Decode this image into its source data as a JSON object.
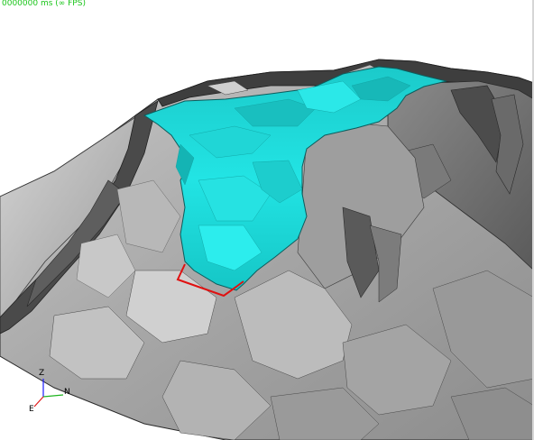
{
  "status": {
    "frame_time": "0000000 ms (∞ FPS)"
  },
  "axes": {
    "z_label": "Z",
    "n_label": "N",
    "e_label": "E",
    "z_color": "#1a1aff",
    "n_color": "#1fb51f",
    "e_color": "#e01a1a"
  },
  "colors": {
    "terrain_light": "#d2d2d2",
    "terrain_mid": "#a0a0a0",
    "terrain_dark": "#3c3c3c",
    "water": "#1ee0e0",
    "selection_outline": "#e01010",
    "status_text": "#18c418"
  }
}
